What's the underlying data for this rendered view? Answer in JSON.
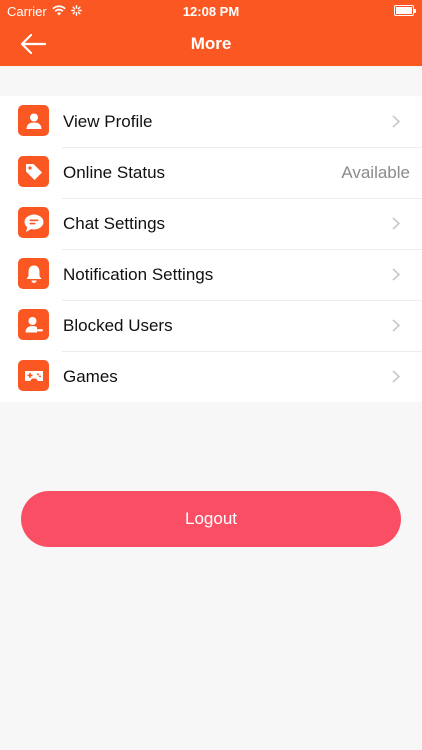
{
  "status_bar": {
    "carrier": "Carrier",
    "time": "12:08 PM"
  },
  "nav": {
    "title": "More",
    "back_icon": "arrow-left-icon"
  },
  "menu": {
    "items": [
      {
        "label": "View Profile",
        "icon": "user-icon",
        "value": ""
      },
      {
        "label": "Online Status",
        "icon": "tag-icon",
        "value": "Available"
      },
      {
        "label": "Chat Settings",
        "icon": "chat-bubble-icon",
        "value": ""
      },
      {
        "label": "Notification Settings",
        "icon": "bell-icon",
        "value": ""
      },
      {
        "label": "Blocked Users",
        "icon": "blocked-user-icon",
        "value": ""
      },
      {
        "label": "Games",
        "icon": "gamepad-icon",
        "value": ""
      }
    ]
  },
  "logout": {
    "label": "Logout"
  },
  "colors": {
    "accent": "#fb5722",
    "logout": "#f94e63",
    "background": "#f7f7f7"
  }
}
